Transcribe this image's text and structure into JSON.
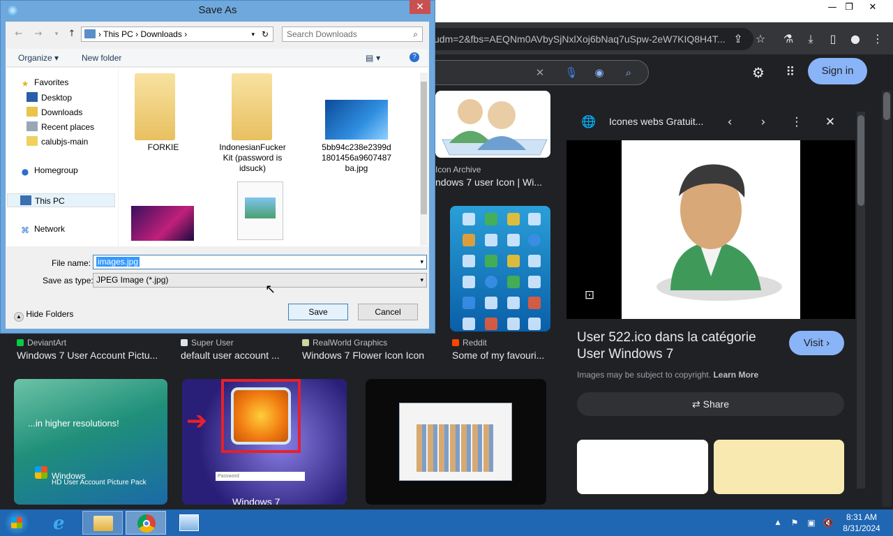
{
  "browser": {
    "url_fragment": "udm=2&fbs=AEQNm0AVbySjNxlXoj6bNaq7uSpw-2eW7KIQ8H4T...",
    "sign_in": "Sign in"
  },
  "results": [
    {
      "source": "Icon Archive",
      "title": "ndows 7 user Icon | Wi..."
    },
    {
      "source": "DeviantArt",
      "title": "Windows 7 User Account Pictu..."
    },
    {
      "source": "Super User",
      "title": "default user account ..."
    },
    {
      "source": "RealWorld Graphics",
      "title": "Windows 7 Flower Icon Icon"
    },
    {
      "source": "Reddit",
      "title": "Some of my favouri..."
    }
  ],
  "thumb_text": {
    "hd_pack_line1": "...in higher resolutions!",
    "hd_pack_line2": "Windows",
    "hd_pack_line3": "HD User Account Picture Pack",
    "password": "Password",
    "win7": "Windows 7"
  },
  "panel": {
    "site": "Icones webs Gratuit...",
    "title": "User 522.ico dans la catégorie User Windows 7",
    "visit": "Visit",
    "copyright": "Images may be subject to copyright.",
    "learn_more": "Learn More",
    "share": "Share"
  },
  "dialog": {
    "title": "Save As",
    "breadcrumb": [
      "This PC",
      "Downloads"
    ],
    "search_placeholder": "Search Downloads",
    "organize": "Organize",
    "new_folder": "New folder",
    "nav": [
      "Favorites",
      "Desktop",
      "Downloads",
      "Recent places",
      "calubjs-main",
      "Homegroup",
      "This PC",
      "Network"
    ],
    "files": [
      {
        "name": "FORKIE"
      },
      {
        "name": "IndonesianFucker Kit (password is idsuck)"
      },
      {
        "name": "5bb94c238e2399d 1801456a9607487 ba.jpg"
      }
    ],
    "file_name_label": "File name:",
    "file_name_value": "images.jpg",
    "save_type_label": "Save as type:",
    "save_type_value": "JPEG Image (*.jpg)",
    "hide_folders": "Hide Folders",
    "save": "Save",
    "cancel": "Cancel"
  },
  "taskbar": {
    "time": "8:31 AM",
    "date": "8/31/2024"
  }
}
